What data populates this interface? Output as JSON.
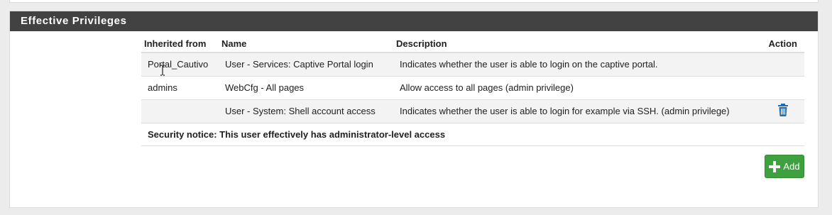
{
  "panel": {
    "title": "Effective Privileges"
  },
  "table": {
    "headers": {
      "inherited_from": "Inherited from",
      "name": "Name",
      "description": "Description",
      "action": "Action"
    },
    "rows": [
      {
        "inherited_from": "Portal_Cautivo",
        "name": "User - Services: Captive Portal login",
        "description": "Indicates whether the user is able to login on the captive portal.",
        "action_icon": ""
      },
      {
        "inherited_from": "admins",
        "name": "WebCfg - All pages",
        "description": "Allow access to all pages (admin privilege)",
        "action_icon": ""
      },
      {
        "inherited_from": "",
        "name": "User - System: Shell account access",
        "description": "Indicates whether the user is able to login for example via SSH. (admin privilege)",
        "action_icon": "trash-icon"
      }
    ],
    "security_notice": "Security notice: This user effectively has administrator-level access"
  },
  "add_button": {
    "label": "Add",
    "icon": "plus-icon"
  },
  "colors": {
    "heading_bg": "#424242",
    "add_button": "#3ea03f",
    "trash_icon": "#1f6fb0"
  }
}
